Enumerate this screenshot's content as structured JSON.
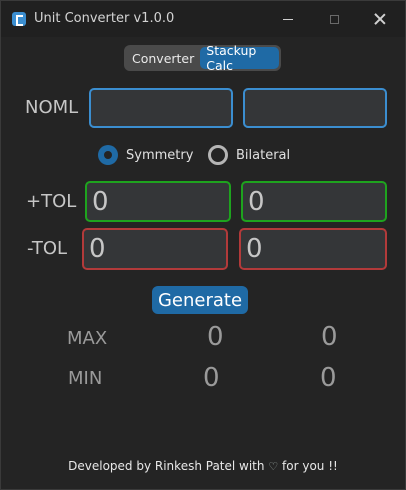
{
  "window": {
    "title": "Unit Converter v1.0.0",
    "minimize_glyph": "—",
    "close_glyph": "✕"
  },
  "tabs": [
    {
      "label": "Converter",
      "active": false
    },
    {
      "label": "Stackup Calc",
      "active": true
    }
  ],
  "form": {
    "noml_label": "NOML",
    "noml_values": [
      "",
      ""
    ],
    "symmetry_label": "Symmetry",
    "bilateral_label": "Bilateral",
    "selected_mode": "Symmetry",
    "plus_tol_label": "+TOL",
    "plus_tol_values": [
      "0",
      "0"
    ],
    "minus_tol_label": "-TOL",
    "minus_tol_values": [
      "0",
      "0"
    ]
  },
  "generate_label": "Generate",
  "results": {
    "max_label": "MAX",
    "max_values": [
      "0",
      "0"
    ],
    "min_label": "MIN",
    "min_values": [
      "0",
      "0"
    ]
  },
  "footer": {
    "prefix": "Developed by Rinkesh Patel with",
    "heart_icon": "♡",
    "suffix": "for you !!"
  },
  "colors": {
    "accent": "#1f6aa5",
    "noml_border": "#3b8ed0",
    "plus_border": "#1ea31e",
    "minus_border": "#b23a3a"
  }
}
